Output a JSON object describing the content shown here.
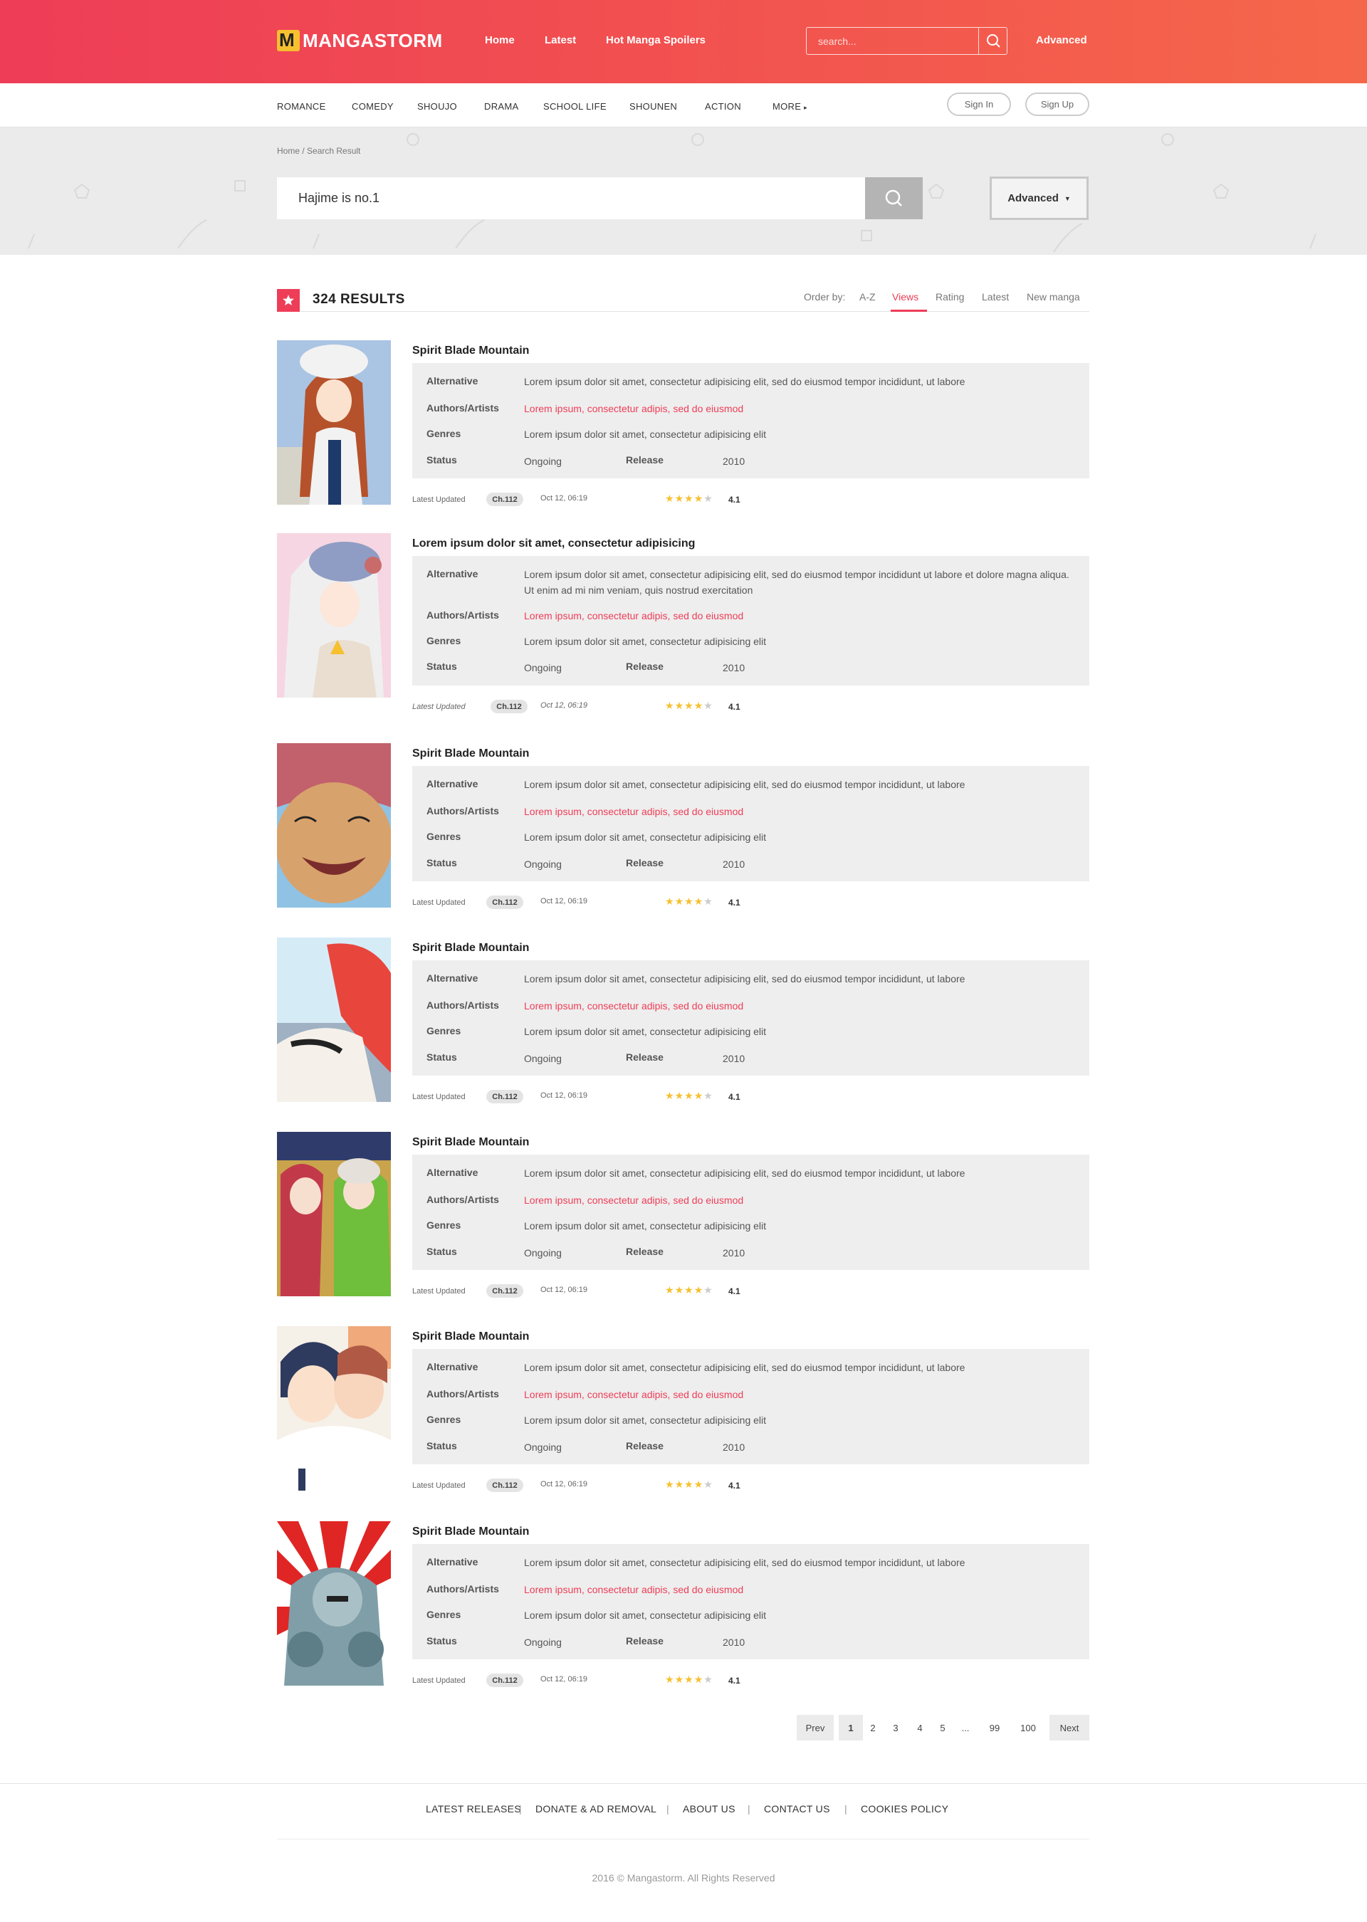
{
  "header": {
    "logo_text": "MANGASTORM",
    "nav": [
      "Home",
      "Latest",
      "Hot Manga Spoilers"
    ],
    "search_placeholder": "search...",
    "advanced": "Advanced"
  },
  "categories": {
    "items": [
      "ROMANCE",
      "COMEDY",
      "SHOUJO",
      "DRAMA",
      "SCHOOL LIFE",
      "SHOUNEN",
      "ACTION",
      "MORE"
    ],
    "sign_in": "Sign In",
    "sign_up": "Sign Up"
  },
  "search": {
    "breadcrumb": "Home / Search Result",
    "query": "Hajime is no.1",
    "advanced_label": "Advanced"
  },
  "results": {
    "count": "324 RESULTS",
    "order_label": "Order by:",
    "order_options": [
      "A-Z",
      "Views",
      "Rating",
      "Latest",
      "New manga"
    ],
    "active_order": "Views",
    "labels": {
      "alternative": "Alternative",
      "authors": "Authors/Artists",
      "genres": "Genres",
      "status": "Status",
      "release": "Release",
      "updated": "Latest Updated"
    },
    "items": [
      {
        "title": "Spirit Blade Mountain",
        "alternative": "Lorem ipsum dolor sit amet, consectetur adipisicing elit, sed do eiusmod tempor incididunt, ut labore",
        "authors": "Lorem ipsum, consectetur adipis, sed do eiusmod",
        "genres": "Lorem ipsum dolor sit amet, consectetur adipisicing elit",
        "status": "Ongoing",
        "release": "2010",
        "chapter": "Ch.112",
        "date": "Oct 12, 06:19",
        "rating": "4.1",
        "stars": 4
      },
      {
        "title": "Lorem ipsum dolor sit amet, consectetur adipisicing",
        "alternative": "Lorem ipsum dolor sit amet, consectetur adipisicing elit, sed do eiusmod tempor incididunt ut labore et dolore magna aliqua. Ut enim ad mi nim veniam, quis nostrud exercitation",
        "authors": "Lorem ipsum, consectetur adipis, sed do eiusmod",
        "genres": "Lorem ipsum dolor sit amet, consectetur adipisicing elit",
        "status": "Ongoing",
        "release": "2010",
        "chapter": "Ch.112",
        "date": "Oct 12, 06:19",
        "rating": "4.1",
        "stars": 4
      },
      {
        "title": "Spirit Blade Mountain",
        "alternative": "Lorem ipsum dolor sit amet, consectetur adipisicing elit, sed do eiusmod tempor incididunt, ut labore",
        "authors": "Lorem ipsum, consectetur adipis, sed do eiusmod",
        "genres": "Lorem ipsum dolor sit amet, consectetur adipisicing elit",
        "status": "Ongoing",
        "release": "2010",
        "chapter": "Ch.112",
        "date": "Oct 12, 06:19",
        "rating": "4.1",
        "stars": 4
      },
      {
        "title": "Spirit Blade Mountain",
        "alternative": "Lorem ipsum dolor sit amet, consectetur adipisicing elit, sed do eiusmod tempor incididunt, ut labore",
        "authors": "Lorem ipsum, consectetur adipis, sed do eiusmod",
        "genres": "Lorem ipsum dolor sit amet, consectetur adipisicing elit",
        "status": "Ongoing",
        "release": "2010",
        "chapter": "Ch.112",
        "date": "Oct 12, 06:19",
        "rating": "4.1",
        "stars": 4
      },
      {
        "title": "Spirit Blade Mountain",
        "alternative": "Lorem ipsum dolor sit amet, consectetur adipisicing elit, sed do eiusmod tempor incididunt, ut labore",
        "authors": "Lorem ipsum, consectetur adipis, sed do eiusmod",
        "genres": "Lorem ipsum dolor sit amet, consectetur adipisicing elit",
        "status": "Ongoing",
        "release": "2010",
        "chapter": "Ch.112",
        "date": "Oct 12, 06:19",
        "rating": "4.1",
        "stars": 4
      },
      {
        "title": "Spirit Blade Mountain",
        "alternative": "Lorem ipsum dolor sit amet, consectetur adipisicing elit, sed do eiusmod tempor incididunt, ut labore",
        "authors": "Lorem ipsum, consectetur adipis, sed do eiusmod",
        "genres": "Lorem ipsum dolor sit amet, consectetur adipisicing elit",
        "status": "Ongoing",
        "release": "2010",
        "chapter": "Ch.112",
        "date": "Oct 12, 06:19",
        "rating": "4.1",
        "stars": 4
      },
      {
        "title": "Spirit Blade Mountain",
        "alternative": "Lorem ipsum dolor sit amet, consectetur adipisicing elit, sed do eiusmod tempor incididunt, ut labore",
        "authors": "Lorem ipsum, consectetur adipis, sed do eiusmod",
        "genres": "Lorem ipsum dolor sit amet, consectetur adipisicing elit",
        "status": "Ongoing",
        "release": "2010",
        "chapter": "Ch.112",
        "date": "Oct 12, 06:19",
        "rating": "4.1",
        "stars": 4
      }
    ]
  },
  "pagination": {
    "prev": "Prev",
    "pages": [
      "1",
      "2",
      "3",
      "4",
      "5",
      "...",
      "99",
      "100"
    ],
    "current": "1",
    "next": "Next"
  },
  "footer": {
    "links": [
      "LATEST RELEASES",
      "DONATE & AD REMOVAL",
      "ABOUT US",
      "CONTACT US",
      "COOKIES POLICY"
    ],
    "copyright": "2016 © Mangastorm. All Rights Reserved"
  },
  "colors": {
    "accent": "#ee3d57",
    "header_end": "#f5674a",
    "star": "#f6c02f",
    "panel": "#eeeeee"
  }
}
